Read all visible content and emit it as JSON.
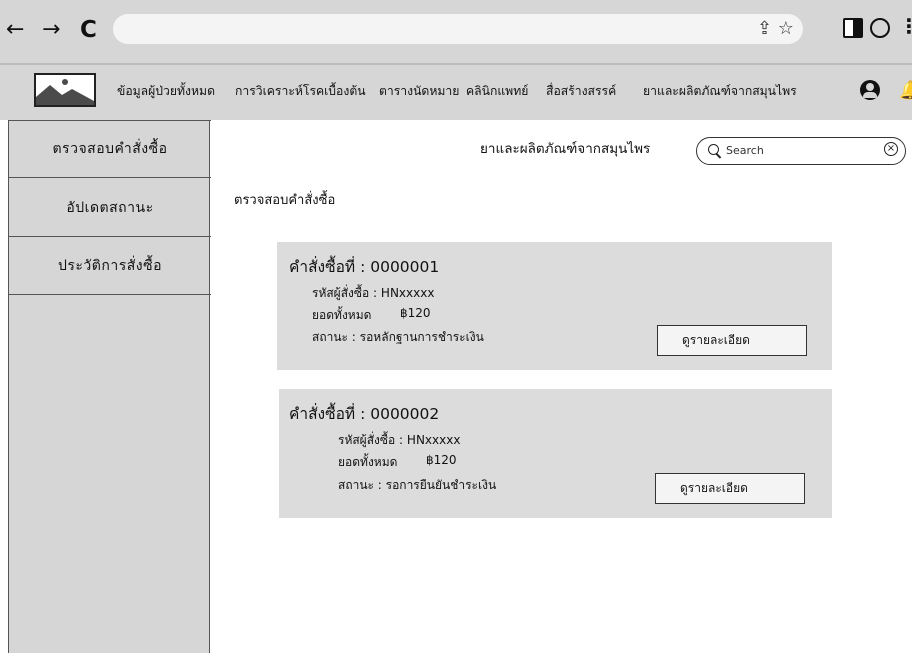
{
  "browser": {
    "back_icon": "←",
    "forward_icon": "→",
    "reload_icon": "C",
    "address_icons": "⇪ ☆"
  },
  "header": {
    "nav_items": [
      "ข้อมูลผู้ป่วยทั้งหมด",
      "การวิเคราะห์โรคเบื้องต้น",
      "ตารางนัดหมาย",
      "คลินิกแพทย์",
      "สื่อสร้างสรรค์",
      "ยาและผลิตภัณฑ์จากสมุนไพร"
    ],
    "icons": [
      "logo-image-icon",
      "user-icon",
      "bell-icon"
    ]
  },
  "sidebar": {
    "items": [
      "ตรวจสอบคำสั่งซื้อ",
      "อัปเดตสถานะ",
      "ประวัติการสั่งซื้อ"
    ]
  },
  "main": {
    "page_title": "ยาและผลิตภัณฑ์จากสมุนไพร",
    "search_placeholder": "Search",
    "section_title": "ตรวจสอบคำสั่งซื้อ",
    "orders": [
      {
        "title": "คำสั่งซื้อที่ : 0000001",
        "customer": "รหัสผู้สั่งซื้อ : HNxxxxx",
        "total_label": "ยอดทั้งหมด",
        "total_value": "฿120",
        "status": "สถานะ : รอหลักฐานการชำระเงิน",
        "detail_button": "ดูรายละเอียด"
      },
      {
        "title": "คำสั่งซื้อที่ : 0000002",
        "customer": "รหัสผู้สั่งซื้อ : HNxxxxx",
        "total_label": "ยอดทั้งหมด",
        "total_value": "฿120",
        "status": "สถานะ : รอการยืนยันชำระเงิน",
        "detail_button": "ดูรายละเอียด"
      }
    ]
  },
  "colors": {
    "chrome_bg": "#d6d6d6",
    "card_bg": "#dcdcdc",
    "button_bg": "#f4f4f4"
  }
}
